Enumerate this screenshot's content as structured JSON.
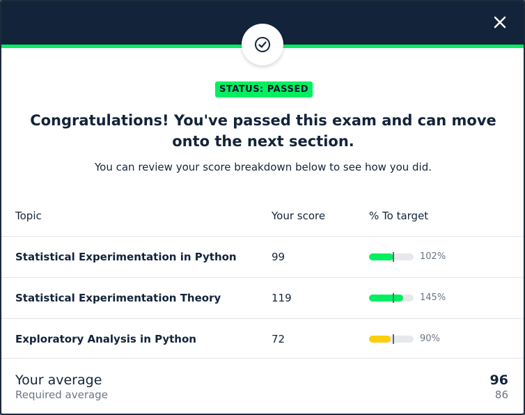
{
  "modal": {
    "status_label": "STATUS: PASSED",
    "headline_line1": "Congratulations! You've passed this exam and can move",
    "headline_line2": "onto the next section.",
    "subline": "You can review your score breakdown below to see how you did.",
    "close_icon": "close-icon",
    "badge_icon": "check-circle-icon"
  },
  "table": {
    "headers": [
      "Topic",
      "Your score",
      "% To target"
    ],
    "rows": [
      {
        "topic": "Statistical Experimentation in Python",
        "score": "99",
        "percent": "102%",
        "fill_percent": 102,
        "color": "#03ef62"
      },
      {
        "topic": "Statistical Experimentation Theory",
        "score": "119",
        "percent": "145%",
        "fill_percent": 145,
        "color": "#03ef62"
      },
      {
        "topic": "Exploratory Analysis in Python",
        "score": "72",
        "percent": "90%",
        "fill_percent": 90,
        "color": "#fcce0d"
      }
    ]
  },
  "summary": {
    "your_average_label": "Your average",
    "your_average_value": "96",
    "required_average_label": "Required average",
    "required_average_value": "86"
  },
  "colors": {
    "header_bg": "#13233a",
    "accent_green": "#03ef62",
    "warning_yellow": "#fcce0d"
  }
}
